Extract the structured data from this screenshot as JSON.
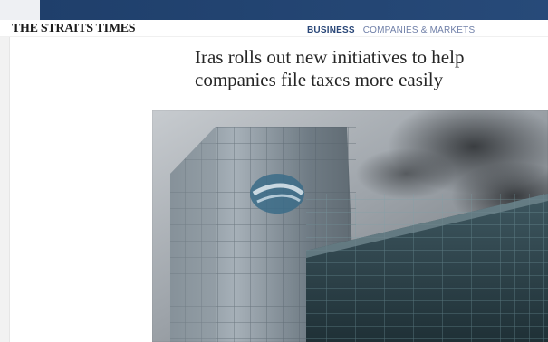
{
  "masthead": {
    "brand": "THE STRAITS TIMES"
  },
  "nav": {
    "primary": "BUSINESS",
    "secondary": "COMPANIES & MARKETS"
  },
  "article": {
    "headline": "Iras rolls out new initiatives to help companies file taxes more easily"
  },
  "colors": {
    "band": "#1f3f6b",
    "nav_primary": "#2a4778",
    "nav_secondary": "#6f7fa8",
    "headline_text": "#262626"
  },
  "icons": {
    "hero_photo": "office-building-photo"
  }
}
